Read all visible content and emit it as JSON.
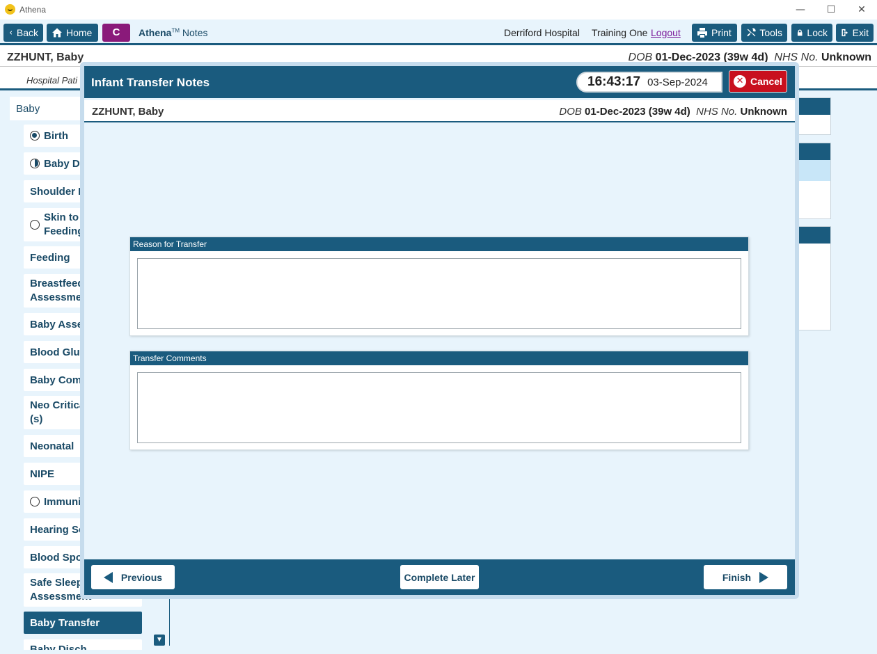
{
  "window": {
    "title": "Athena",
    "minimize": "—",
    "maximize": "☐",
    "close": "✕"
  },
  "toolbar": {
    "back": "Back",
    "home": "Home",
    "c_button": "C",
    "brand": "Athena",
    "brand_tm": "TM",
    "brand_suffix": "Notes",
    "hospital": "Derriford Hospital",
    "user": "Training One",
    "logout": "Logout",
    "print": "Print",
    "tools": "Tools",
    "lock": "Lock",
    "exit": "Exit"
  },
  "patient": {
    "name": "ZZHUNT, Baby",
    "dob_label": "DOB",
    "dob": "01-Dec-2023 (39w 4d)",
    "nhs_label": "NHS No.",
    "nhs": "Unknown"
  },
  "subbar": {
    "text": "Hospital Pati"
  },
  "sidebar": {
    "header": "Baby",
    "items": [
      {
        "label": "Birth",
        "status": "filled"
      },
      {
        "label": "Baby Det",
        "status": "half"
      },
      {
        "label": "Shoulder D",
        "status": "none"
      },
      {
        "label": "Skin to S Feeding",
        "line1": "Skin to S",
        "line2": "Feeding",
        "status": "empty"
      },
      {
        "label": "Feeding",
        "status": "none"
      },
      {
        "label": "Breastfeedi Assessmen",
        "line1": "Breastfeedi",
        "line2": "Assessmen",
        "status": "none"
      },
      {
        "label": "Baby Asses",
        "status": "none"
      },
      {
        "label": "Blood Gluc",
        "status": "none"
      },
      {
        "label": "Baby Comr",
        "status": "none"
      },
      {
        "label": "Neo Critica (s)",
        "line1": "Neo Critica",
        "line2": "(s)",
        "status": "none"
      },
      {
        "label": "Neonatal",
        "status": "none"
      },
      {
        "label": "NIPE",
        "status": "none"
      },
      {
        "label": "Immunis",
        "status": "empty"
      },
      {
        "label": "Hearing Sc",
        "status": "none"
      },
      {
        "label": "Blood Spot",
        "status": "none"
      },
      {
        "label": "Safe Sleepi Assessment",
        "line1": "Safe Sleepi",
        "line2": "Assessment",
        "status": "none"
      },
      {
        "label": "Baby Transfer",
        "status": "active"
      },
      {
        "label": "Baby Disch",
        "status": "none"
      }
    ]
  },
  "dialog": {
    "title": "Infant Transfer Notes",
    "time": "16:43:17",
    "date": "03-Sep-2024",
    "cancel": "Cancel",
    "reason_label": "Reason for Transfer",
    "reason_value": "",
    "comments_label": "Transfer Comments",
    "comments_value": "",
    "previous": "Previous",
    "complete_later": "Complete Later",
    "finish": "Finish"
  },
  "colors": {
    "primary": "#1a5b7e",
    "accent_purple": "#8a1a7a",
    "cancel_red": "#c8101e",
    "background": "#e8f4fc"
  }
}
